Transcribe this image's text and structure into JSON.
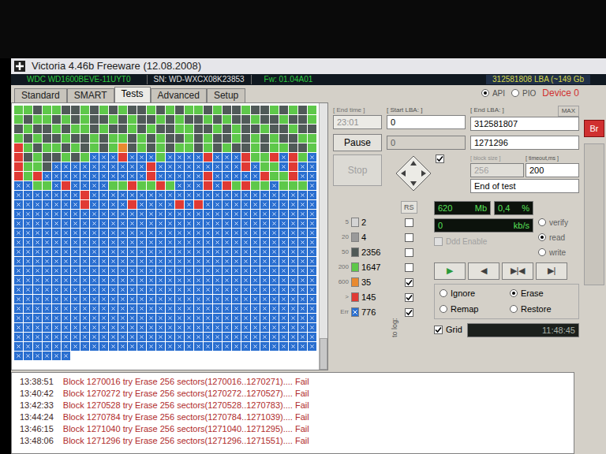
{
  "window": {
    "title": "Victoria 4.46b Freeware (12.08.2008)"
  },
  "drive": {
    "model": "WDC WD1600BEVE-11UYT0",
    "serial": "SN: WD-WXCX08K23853",
    "firmware": "Fw: 01.04A01",
    "capacity": "312581808 LBA (~149 Gb"
  },
  "port": [
    {
      "label": "API",
      "selected": true
    },
    {
      "label": "PIO",
      "selected": false
    }
  ],
  "device": "Device 0",
  "tabs": [
    {
      "label": "Standard",
      "selected": false
    },
    {
      "label": "SMART",
      "selected": false
    },
    {
      "label": "Tests",
      "selected": true
    },
    {
      "label": "Advanced",
      "selected": false
    },
    {
      "label": "Setup",
      "selected": false
    }
  ],
  "fields": {
    "end_time_label": "[ End time ]",
    "end_time": "23:01",
    "start_lba_label": "[ Start LBA: ]",
    "start_lba": "0",
    "end_lba_label": "[ End LBA: ]",
    "max": "MAX",
    "end_lba": "312581807",
    "current_lba": "0",
    "current_end": "1271296",
    "block_size_label": "[ block size ]",
    "block_size": "256",
    "timeout_label": "[ timeout,ms ]",
    "timeout": "200",
    "mode": "End of test"
  },
  "buttons": {
    "pause": "Pause",
    "stop": "Stop",
    "stop_disabled": true,
    "rs": "RS",
    "side": "Br"
  },
  "legend": {
    "to_log": "to log:",
    "items": [
      {
        "label": "5",
        "count": "2",
        "color": "#d4d4d4",
        "kind": "time",
        "to_log": false
      },
      {
        "label": "20",
        "count": "4",
        "color": "#9a9a9a",
        "kind": "time",
        "to_log": false
      },
      {
        "label": "50",
        "count": "2356",
        "color": "#505a58",
        "kind": "time",
        "to_log": false
      },
      {
        "label": "200",
        "count": "1647",
        "color": "#5ec84a",
        "kind": "time",
        "to_log": false
      },
      {
        "label": "600",
        "count": "35",
        "color": "#e88a30",
        "kind": "time",
        "to_log": true
      },
      {
        "label": ">",
        "count": "145",
        "color": "#e03a34",
        "kind": "time",
        "to_log": true
      },
      {
        "label": "Err",
        "count": "776",
        "color": "#2a6fd0",
        "kind": "error",
        "to_log": true
      }
    ]
  },
  "stats": {
    "size": "620",
    "size_unit": "Mb",
    "percent": "0,4",
    "percent_unit": "%",
    "speed": "0",
    "speed_unit": "kb/s"
  },
  "read_modes": [
    {
      "label": "verify",
      "selected": false
    },
    {
      "label": "read",
      "selected": true
    },
    {
      "label": "write",
      "selected": false
    }
  ],
  "ddd": {
    "label": "Ddd Enable",
    "checked": false,
    "disabled": true
  },
  "transport": [
    "▶",
    "◀",
    "▶|◀",
    "▶|"
  ],
  "actions": [
    {
      "label": "Ignore",
      "selected": false
    },
    {
      "label": "Erase",
      "selected": true
    },
    {
      "label": "Remap",
      "selected": false
    },
    {
      "label": "Restore",
      "selected": false
    }
  ],
  "grid_option": {
    "label": "Grid",
    "checked": true
  },
  "timer": "11:48:45",
  "map": {
    "cells": [
      [
        3,
        3,
        2,
        3,
        3,
        2,
        2,
        3,
        2,
        3,
        2,
        3,
        2,
        2,
        3,
        2,
        3,
        2,
        3,
        3,
        2,
        3,
        2,
        2,
        3,
        2,
        2,
        3,
        2,
        3,
        2,
        3
      ],
      [
        3,
        2,
        3,
        3,
        2,
        3,
        2,
        3,
        2,
        2,
        3,
        2,
        3,
        2,
        2,
        3,
        2,
        3,
        2,
        2,
        3,
        2,
        3,
        2,
        2,
        3,
        2,
        2,
        3,
        2,
        2,
        3
      ],
      [
        2,
        3,
        2,
        2,
        3,
        2,
        3,
        3,
        2,
        3,
        2,
        2,
        3,
        2,
        3,
        2,
        2,
        3,
        3,
        2,
        2,
        3,
        2,
        3,
        2,
        2,
        3,
        2,
        2,
        3,
        2,
        2
      ],
      [
        3,
        2,
        3,
        2,
        2,
        3,
        2,
        2,
        3,
        2,
        3,
        3,
        2,
        3,
        2,
        3,
        2,
        2,
        3,
        2,
        3,
        2,
        2,
        3,
        2,
        3,
        2,
        3,
        2,
        2,
        3,
        3
      ],
      [
        5,
        3,
        2,
        3,
        3,
        2,
        3,
        2,
        3,
        2,
        3,
        4,
        2,
        3,
        2,
        3,
        2,
        3,
        3,
        2,
        3,
        2,
        3,
        2,
        2,
        3,
        2,
        3,
        3,
        2,
        2,
        3
      ],
      [
        5,
        2,
        3,
        2,
        2,
        3,
        2,
        3,
        6,
        6,
        6,
        5,
        6,
        6,
        6,
        3,
        6,
        6,
        6,
        6,
        5,
        6,
        6,
        6,
        5,
        3,
        3,
        5,
        6,
        5,
        3,
        6
      ],
      [
        5,
        3,
        3,
        2,
        6,
        6,
        6,
        6,
        6,
        6,
        6,
        6,
        6,
        6,
        5,
        6,
        6,
        6,
        6,
        6,
        6,
        6,
        6,
        6,
        5,
        6,
        3,
        3,
        6,
        5,
        6,
        6
      ],
      [
        5,
        3,
        5,
        6,
        6,
        6,
        6,
        6,
        6,
        6,
        6,
        6,
        6,
        6,
        5,
        6,
        6,
        6,
        6,
        6,
        5,
        6,
        6,
        6,
        6,
        6,
        5,
        3,
        3,
        5,
        6,
        6
      ],
      [
        6,
        6,
        3,
        3,
        6,
        5,
        6,
        6,
        6,
        6,
        3,
        3,
        5,
        3,
        3,
        5,
        3,
        6,
        6,
        6,
        5,
        6,
        5,
        3,
        5,
        3,
        3,
        6,
        3,
        3,
        3,
        6
      ],
      [
        6,
        6,
        6,
        6,
        6,
        6,
        6,
        5,
        6,
        6,
        6,
        6,
        6,
        6,
        6,
        6,
        6,
        6,
        6,
        6,
        6,
        6,
        6,
        6,
        6,
        6,
        6,
        6,
        6,
        6,
        6,
        6
      ],
      [
        6,
        6,
        6,
        6,
        6,
        6,
        6,
        5,
        6,
        6,
        6,
        6,
        5,
        6,
        6,
        6,
        6,
        5,
        6,
        5,
        6,
        6,
        6,
        6,
        6,
        6,
        6,
        6,
        6,
        6,
        6,
        6
      ],
      [
        6,
        6,
        6,
        6,
        6,
        6,
        6,
        6,
        6,
        6,
        6,
        6,
        6,
        6,
        6,
        6,
        6,
        6,
        6,
        6,
        6,
        6,
        6,
        6,
        6,
        6,
        6,
        6,
        6,
        6,
        6,
        6
      ],
      [
        6,
        6,
        6,
        6,
        6,
        6,
        6,
        6,
        6,
        6,
        6,
        6,
        6,
        6,
        6,
        6,
        6,
        6,
        6,
        6,
        6,
        6,
        6,
        6,
        6,
        6,
        6,
        6,
        6,
        6,
        6,
        6
      ],
      [
        6,
        6,
        6,
        6,
        6,
        6,
        6,
        6,
        6,
        6,
        6,
        6,
        6,
        6,
        6,
        6,
        6,
        6,
        6,
        6,
        6,
        6,
        6,
        6,
        6,
        6,
        6,
        6,
        6,
        6,
        6,
        6
      ],
      [
        6,
        6,
        6,
        6,
        6,
        6,
        6,
        6,
        6,
        6,
        6,
        6,
        6,
        6,
        6,
        6,
        6,
        6,
        6,
        6,
        6,
        6,
        6,
        6,
        6,
        6,
        6,
        6,
        6,
        6,
        6,
        6
      ],
      [
        6,
        6,
        6,
        6,
        6,
        6,
        6,
        6,
        6,
        6,
        6,
        6,
        6,
        6,
        6,
        6,
        6,
        6,
        6,
        6,
        6,
        6,
        6,
        6,
        6,
        6,
        6,
        6,
        6,
        6,
        6,
        6
      ],
      [
        6,
        6,
        6,
        6,
        6,
        6,
        6,
        6,
        6,
        6,
        6,
        6,
        6,
        6,
        6,
        6,
        6,
        6,
        6,
        6,
        6,
        6,
        6,
        6,
        6,
        6,
        6,
        6,
        6,
        6,
        6,
        6
      ],
      [
        6,
        6,
        6,
        6,
        6,
        6,
        6,
        6,
        6,
        6,
        6,
        6,
        6,
        6,
        6,
        6,
        6,
        6,
        6,
        6,
        6,
        6,
        6,
        6,
        6,
        6,
        6,
        6,
        6,
        6,
        6,
        6
      ],
      [
        6,
        6,
        6,
        6,
        6,
        6,
        6,
        6,
        6,
        6,
        6,
        6,
        6,
        6,
        6,
        6,
        6,
        6,
        6,
        6,
        6,
        6,
        6,
        6,
        6,
        6,
        6,
        6,
        6,
        6,
        6,
        6
      ],
      [
        6,
        6,
        6,
        6,
        6,
        6,
        6,
        6,
        6,
        6,
        6,
        6,
        6,
        6,
        6,
        6,
        6,
        6,
        6,
        6,
        6,
        6,
        6,
        6,
        6,
        6,
        6,
        6,
        6,
        6,
        6,
        6
      ],
      [
        6,
        6,
        6,
        6,
        6,
        6,
        6,
        6,
        6,
        6,
        6,
        6,
        6,
        6,
        6,
        6,
        6,
        6,
        6,
        6,
        6,
        6,
        6,
        6,
        6,
        6,
        6,
        6,
        6,
        6,
        6,
        6
      ],
      [
        6,
        6,
        6,
        6,
        6,
        6,
        6,
        6,
        6,
        6,
        6,
        6,
        6,
        6,
        6,
        6,
        6,
        6,
        6,
        6,
        6,
        6,
        6,
        6,
        6,
        6,
        6,
        6,
        6,
        6,
        6,
        6
      ],
      [
        6,
        6,
        6,
        6,
        6,
        6,
        6,
        6,
        6,
        6,
        6,
        6,
        6,
        6,
        6,
        6,
        6,
        6,
        6,
        6,
        6,
        6,
        6,
        6,
        6,
        6,
        6,
        6,
        6,
        6,
        6,
        6
      ],
      [
        6,
        6,
        6,
        6,
        6,
        6,
        6,
        6,
        6,
        6,
        6,
        6,
        6,
        6,
        6,
        6,
        6,
        6,
        6,
        6,
        6,
        6,
        6,
        6,
        6,
        6,
        6,
        6,
        6,
        6,
        6,
        6
      ],
      [
        6,
        6,
        6,
        6,
        6,
        6,
        6,
        6,
        6,
        6,
        6,
        6,
        6,
        6,
        6,
        6,
        6,
        6,
        6,
        6,
        6,
        6,
        6,
        6,
        6,
        6,
        6,
        6,
        6,
        6,
        6,
        6
      ],
      [
        6,
        6,
        6,
        6,
        6,
        6,
        6,
        6,
        6,
        6,
        6,
        6,
        6,
        6,
        6,
        6,
        6,
        6,
        6,
        6,
        6,
        6,
        6,
        6,
        6,
        6,
        6,
        6,
        6,
        6,
        6,
        6
      ],
      [
        6,
        6,
        6,
        6,
        6,
        6
      ]
    ]
  },
  "log": [
    {
      "time": "13:38:51",
      "message": "Block 1270016 try Erase 256 sectors(1270016..1270271).... Fail"
    },
    {
      "time": "13:40:42",
      "message": "Block 1270272 try Erase 256 sectors(1270272..1270527).... Fail"
    },
    {
      "time": "13:42:33",
      "message": "Block 1270528 try Erase 256 sectors(1270528..1270783).... Fail"
    },
    {
      "time": "13:44:24",
      "message": "Block 1270784 try Erase 256 sectors(1270784..1271039).... Fail"
    },
    {
      "time": "13:46:15",
      "message": "Block 1271040 try Erase 256 sectors(1271040..1271295).... Fail"
    },
    {
      "time": "13:48:06",
      "message": "Block 1271296 try Erase 256 sectors(1271296..1271551).... Fail"
    }
  ]
}
